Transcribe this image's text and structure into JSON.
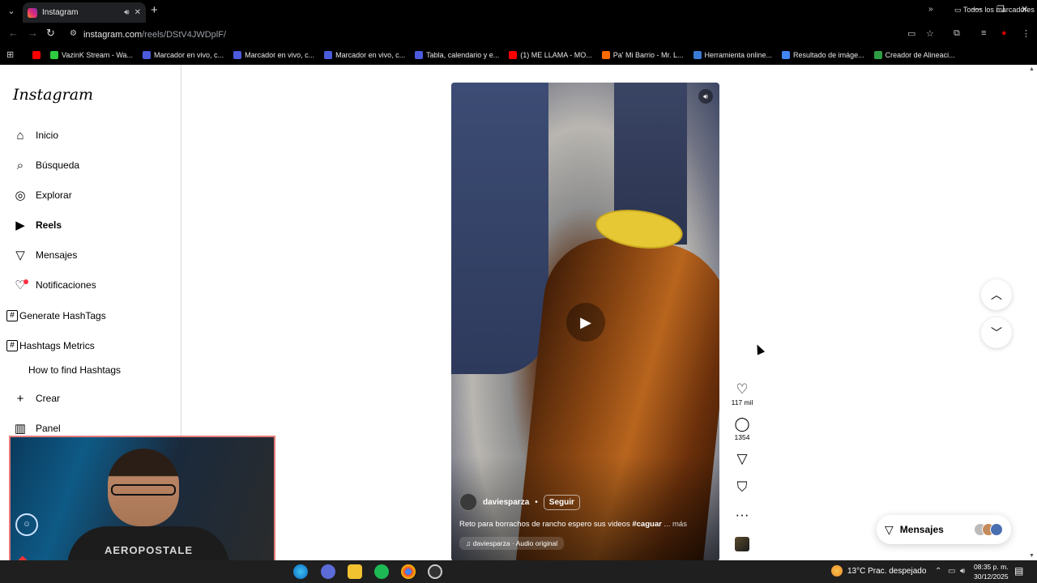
{
  "browser": {
    "tab_title": "Instagram",
    "url_host": "instagram.com",
    "url_path": "/reels/DStV4JWDplF/",
    "bookmarks": [
      {
        "label": "VazinK Stream - Wa...",
        "color": "#2ecc40"
      },
      {
        "label": "Marcador en vivo, c...",
        "color": "#4b5bdc"
      },
      {
        "label": "Marcador en vivo, c...",
        "color": "#4b5bdc"
      },
      {
        "label": "Marcador en vivo, c...",
        "color": "#4b5bdc"
      },
      {
        "label": "Tabla, calendario y e...",
        "color": "#4b5bdc"
      },
      {
        "label": "(1) ME LLAMA - MO...",
        "color": "#ff0000"
      },
      {
        "label": "Pa' Mi Barrio - Mr. L...",
        "color": "#ff6a00"
      },
      {
        "label": "Herramienta online...",
        "color": "#3a7bd5"
      },
      {
        "label": "Resultado de imáge...",
        "color": "#4285f4"
      },
      {
        "label": "Creador de Alineaci...",
        "color": "#2e9e44"
      }
    ],
    "all_bookmarks": "Todos los marcadores"
  },
  "sidebar": {
    "logo": "Instagram",
    "items": [
      {
        "label": "Inicio",
        "icon": "home-icon"
      },
      {
        "label": "Búsqueda",
        "icon": "search-icon"
      },
      {
        "label": "Explorar",
        "icon": "compass-icon"
      },
      {
        "label": "Reels",
        "icon": "reels-icon"
      },
      {
        "label": "Mensajes",
        "icon": "send-icon"
      },
      {
        "label": "Notificaciones",
        "icon": "heart-icon"
      }
    ],
    "hashtag_items": [
      {
        "label": "Generate HashTags"
      },
      {
        "label": "Hashtags Metrics"
      }
    ],
    "subitem": "How to find Hashtags",
    "create": "Crear",
    "panel": "Panel"
  },
  "reel": {
    "username": "daviesparza",
    "follow": "Seguir",
    "caption": "Reto para borrachos de rancho espero sus videos ",
    "hashtag": "#caguar",
    "more": " ... más",
    "audio": "daviesparza · Audio original",
    "likes": "117 mil",
    "comments": "1354"
  },
  "messages_pill": {
    "label": "Mensajes"
  },
  "webcam": {
    "shirt_text": "AEROPOSTALE"
  },
  "taskbar": {
    "weather": "13°C  Prac. despejado",
    "time": "08:35 p. m.",
    "date": "30/12/2025"
  },
  "colors": {
    "accent_notification": "#ff3040",
    "webcam_border": "#e57a7a"
  }
}
